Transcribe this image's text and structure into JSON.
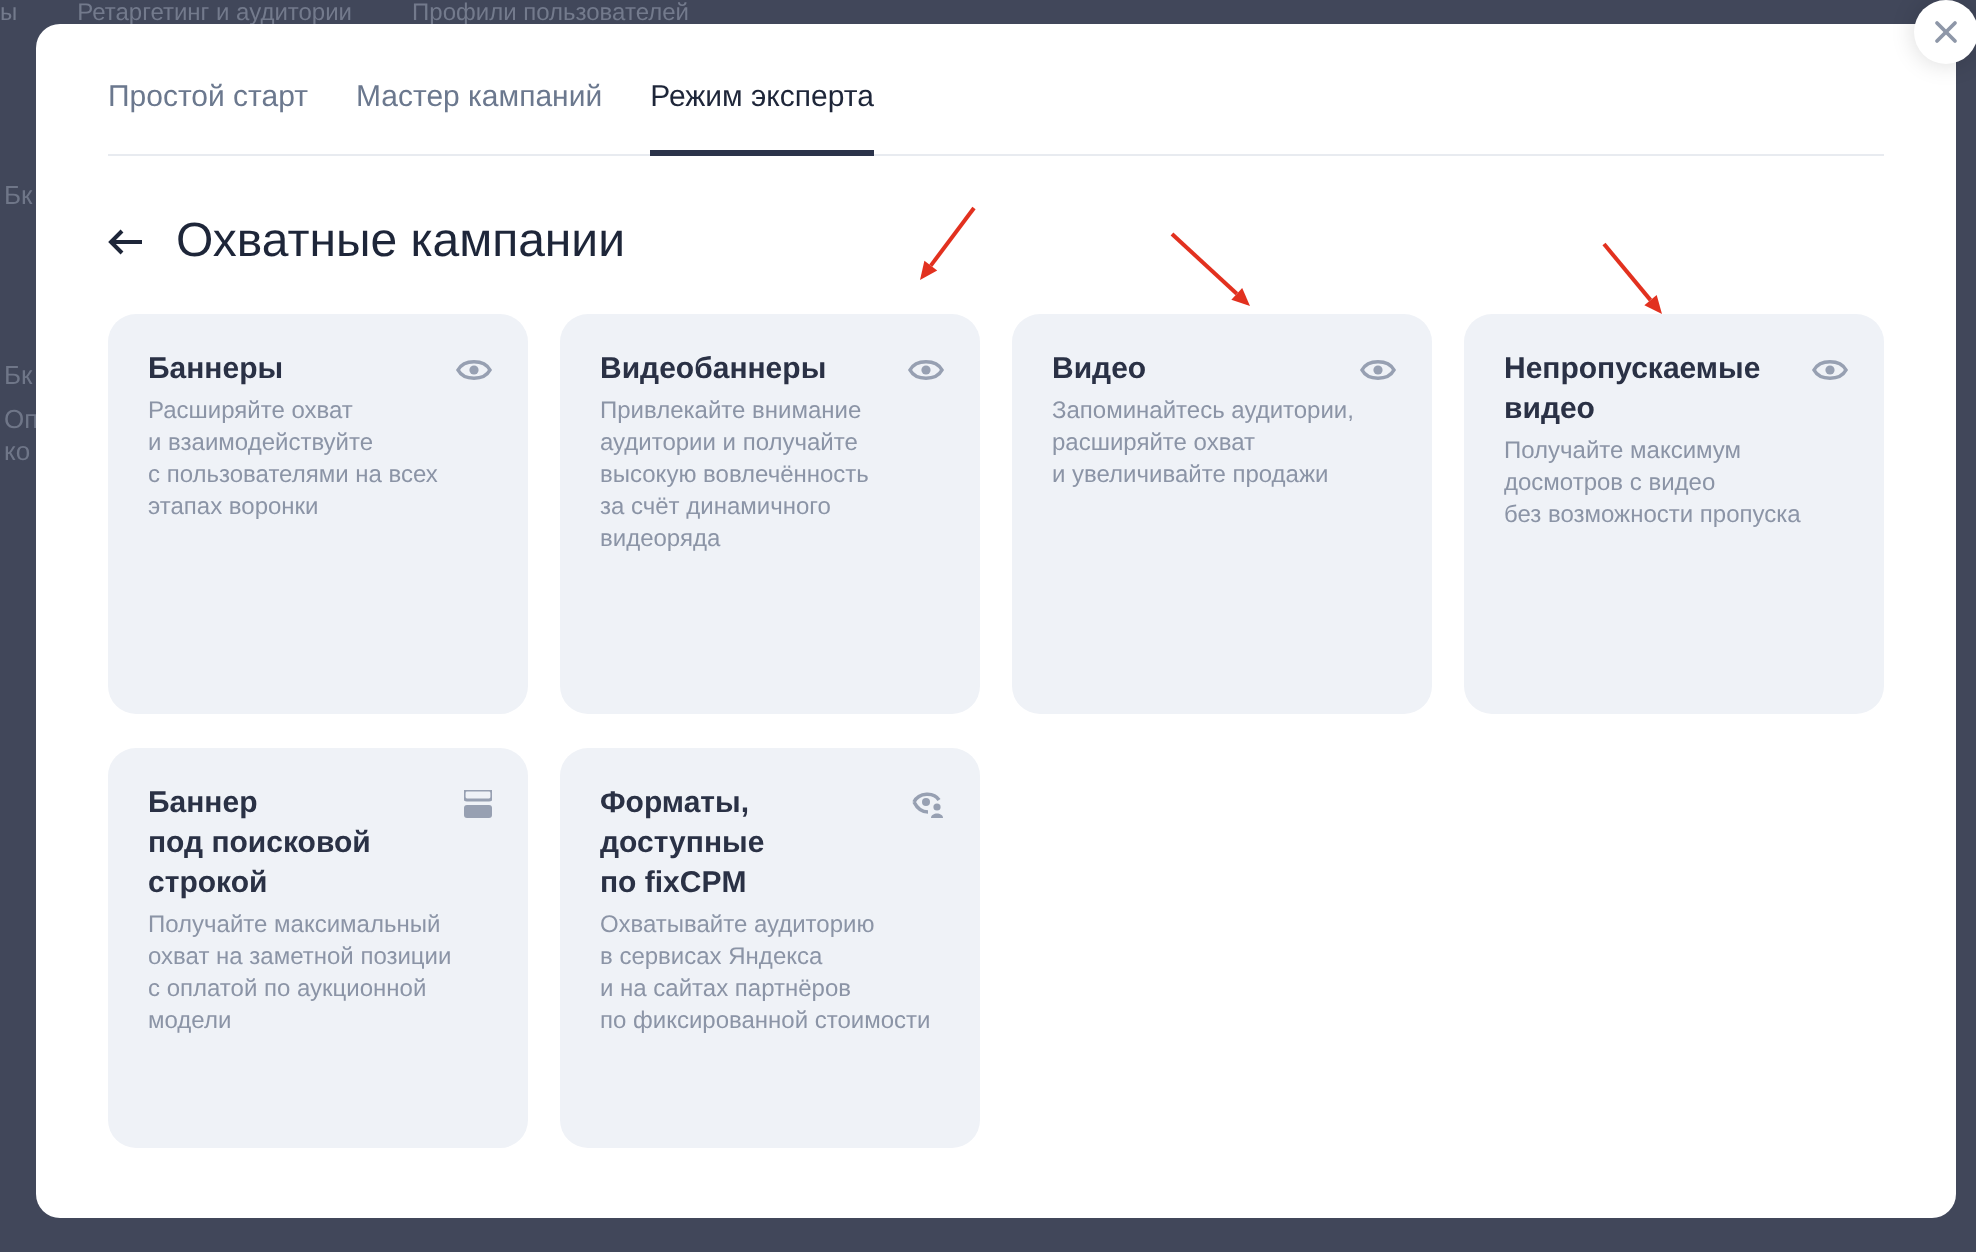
{
  "background_page": {
    "nav": [
      "ы",
      "Ретаргетинг и аудитории",
      "Профили пользователей"
    ],
    "side_fragments": [
      "Бк",
      "Бк",
      "Оп",
      "ко"
    ]
  },
  "dialog": {
    "tabs": [
      {
        "label": "Простой старт",
        "selected": false
      },
      {
        "label": "Мастер кампаний",
        "selected": false
      },
      {
        "label": "Режим эксперта",
        "selected": true
      }
    ],
    "title": "Охватные кампании",
    "cards": [
      {
        "kind": "standard",
        "title": "Баннеры",
        "description": "Расширяйте охват\nи взаимодействуйте\nс пользователями на всех\nэтапах воронки"
      },
      {
        "kind": "standard",
        "title": "Видеобаннеры",
        "description": "Привлекайте внимание\nаудитории и получайте\nвысокую вовлечённость\nза счёт динамичного\nвидеоряда"
      },
      {
        "kind": "standard",
        "title": "Видео",
        "description": "Запоминайтесь аудитории,\nрасширяйте охват\nи увеличивайте продажи"
      },
      {
        "kind": "standard",
        "title": "Непропускаемые\nвидео",
        "description": "Получайте максимум\nдосмотров с видео\nбез возможности пропуска"
      },
      {
        "kind": "search-banner",
        "title": "Баннер\nпод поисковой\nстрокой",
        "description": "Получайте максимальный\nохват на заметной позиции\nс оплатой по аукционной\nмодели"
      },
      {
        "kind": "fixcpm",
        "title": "Форматы,\nдоступные\nпо fixCPM",
        "description": "Охватывайте аудиторию\nв сервисах Яндекса\nи на сайтах партнёров\nпо фиксированной стоимости"
      }
    ]
  }
}
